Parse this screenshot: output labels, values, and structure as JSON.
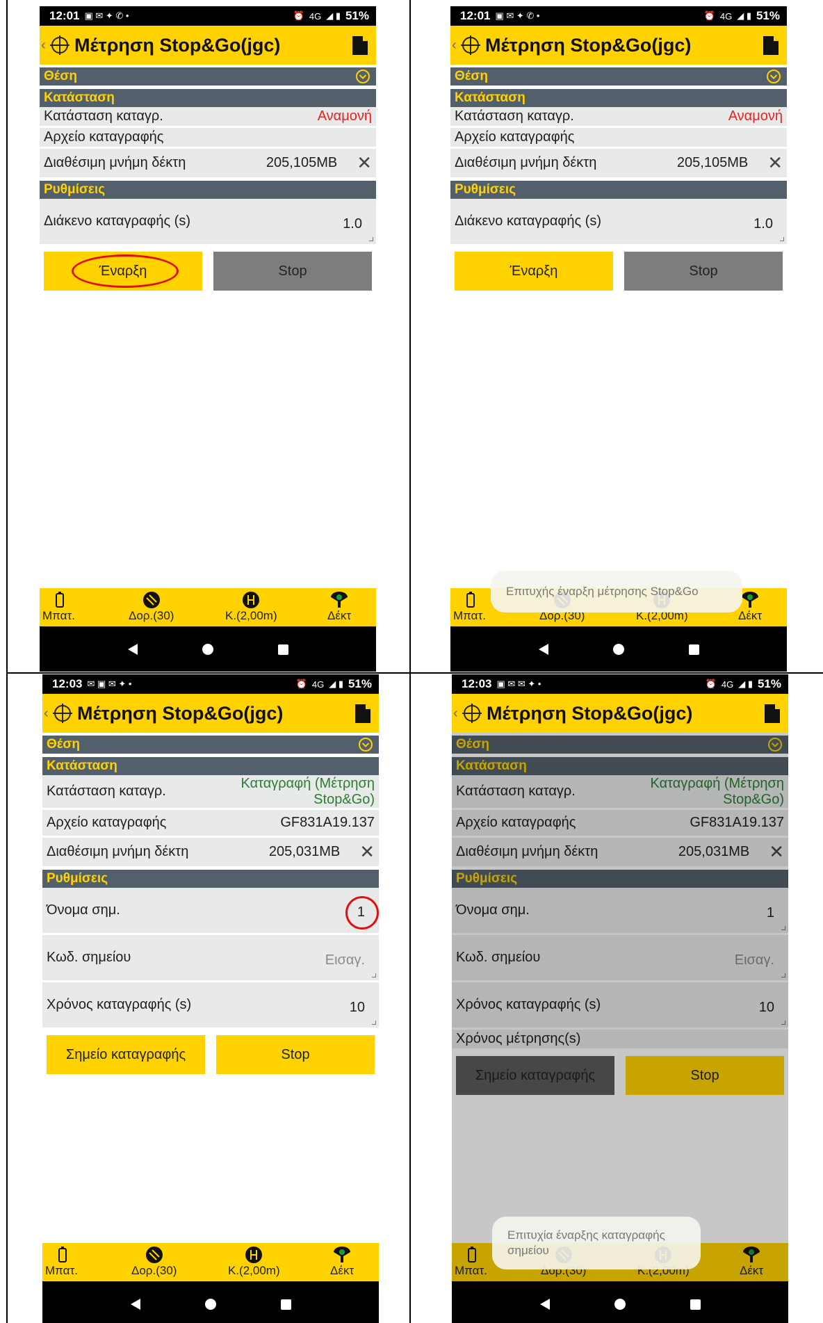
{
  "app": {
    "title": "Μέτρηση Stop&Go(jgc)",
    "section_position": "Θέση",
    "section_status": "Κατάσταση",
    "section_settings": "Ρυθμίσεις"
  },
  "labels": {
    "record_status": "Κατάσταση καταγρ.",
    "record_file": "Αρχείο καταγραφής",
    "free_memory": "Διαθέσιμη μνήμη δέκτη",
    "interval": "Διάκενο καταγραφής (s)",
    "point_name": "Όνομα σημ.",
    "point_code": "Κωδ. σημείου",
    "record_time": "Χρόνος καταγραφής (s)",
    "measure_time": "Χρόνος μέτρησης(s)"
  },
  "bottom": {
    "battery": "Μπατ.",
    "satellites": "Δορ.(30)",
    "height": "Κ.(2,00m)",
    "receiver": "Δέκτ"
  },
  "colors": {
    "accent_yellow": "#ffd200",
    "section_bg": "#53606b",
    "status_waiting": "#e42222",
    "status_recording": "#2e7d32",
    "highlight_ring": "#e01010"
  },
  "icons": {
    "status_bar_left": [
      "video-icon",
      "mail-icon",
      "twitter-icon",
      "whatsapp-icon"
    ],
    "status_bar_right": [
      "alarm-icon",
      "4g-signal-icon",
      "battery-icon"
    ],
    "title": [
      "back-icon",
      "crosshair-icon",
      "file-icon"
    ],
    "bottom": [
      "battery-icon",
      "satellite-icon",
      "antenna-height-icon",
      "receiver-icon"
    ],
    "nav": [
      "nav-back-icon",
      "nav-home-icon",
      "nav-recent-icon"
    ]
  },
  "screens": [
    {
      "time": "12:01",
      "battery": "51%",
      "network": "4G",
      "status_value": "Αναμονή",
      "memory_value": "205,105MB",
      "interval_value": "1.0",
      "start_button": "Έναρξη",
      "stop_button": "Stop",
      "highlight": "start-button"
    },
    {
      "time": "12:01",
      "battery": "51%",
      "network": "4G",
      "status_value": "Αναμονή",
      "memory_value": "205,105MB",
      "interval_value": "1.0",
      "start_button": "Έναρξη",
      "stop_button": "Stop",
      "toast": "Επιτυχής έναρξη μέτρησης Stop&Go"
    },
    {
      "time": "12:03",
      "battery": "51%",
      "network": "4G",
      "status_value": "Καταγραφή (Μέτρηση Stop&Go)",
      "file_value": "GF831A19.137",
      "memory_value": "205,031MB",
      "point_name_value": "1",
      "point_code_placeholder": "Εισαγ.",
      "record_time_value": "10",
      "record_point_button": "Σημείο καταγραφής",
      "stop_button": "Stop",
      "highlight": "point-name-value"
    },
    {
      "time": "12:03",
      "battery": "51%",
      "network": "4G",
      "status_value": "Καταγραφή (Μέτρηση Stop&Go)",
      "file_value": "GF831A19.137",
      "memory_value": "205,031MB",
      "point_name_value": "1",
      "point_code_placeholder": "Εισαγ.",
      "record_time_value": "10",
      "record_point_button": "Σημείο καταγραφής",
      "stop_button": "Stop",
      "toast": "Επιτυχία έναρξης καταγραφής σημείου"
    }
  ]
}
